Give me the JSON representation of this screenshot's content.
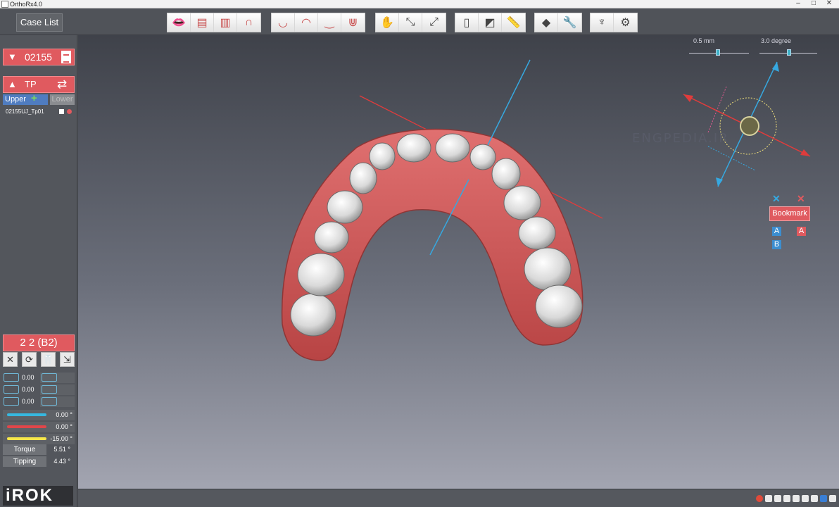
{
  "window": {
    "title": "OrthoRx4.0",
    "min": "–",
    "max": "□",
    "close": "✕"
  },
  "toolbar": {
    "case_list_label": "Case List",
    "groups": [
      {
        "icons": [
          "occlusion-front-icon",
          "upper-jaw-front-icon",
          "lower-jaw-front-icon",
          "arch-outline-icon"
        ],
        "glyphs": [
          "👄",
          "▤",
          "▥",
          "∩"
        ]
      },
      {
        "icons": [
          "upper-teeth-view-icon",
          "lower-teeth-view-icon",
          "gum-view-icon",
          "full-arch-teeth-icon"
        ],
        "glyphs": [
          "◡",
          "◠",
          "‿",
          "⋓"
        ]
      },
      {
        "icons": [
          "hand-pan-icon",
          "shrink-view-icon",
          "expand-view-icon"
        ],
        "glyphs": [
          "✋",
          "⤡",
          "⤢"
        ]
      },
      {
        "icons": [
          "tooth-split-icon",
          "tooth-shape-icon",
          "ruler-icon"
        ],
        "glyphs": [
          "▯",
          "◩",
          "📏"
        ]
      },
      {
        "icons": [
          "eraser-icon",
          "wrench-icon"
        ],
        "glyphs": [
          "◆",
          "🔧"
        ]
      },
      {
        "icons": [
          "jaw-model-icon",
          "attachments-icon"
        ],
        "glyphs": [
          "♆",
          "⚙"
        ]
      }
    ]
  },
  "left_panel": {
    "case_id": "02155",
    "plan_label": "TP",
    "jaw_upper_label": "Upper",
    "jaw_lower_label": "Lower",
    "stage_name": "02155UJ_Tp01",
    "selected_tooth": "2 2 (B2)",
    "tool_buttons": [
      "✕",
      "⟳",
      "🦷",
      "⇲"
    ],
    "rows": [
      {
        "value": "0.00"
      },
      {
        "value": "0.00"
      },
      {
        "value": "0.00"
      }
    ],
    "bars": [
      {
        "color": "#36b8e0",
        "value": "0.00 °"
      },
      {
        "color": "#e0464a",
        "value": "0.00 °"
      },
      {
        "color": "#f5e64a",
        "value": "-15.00 °"
      }
    ],
    "torque_label": "Torque",
    "torque_value": "5.51 °",
    "tipping_label": "Tipping",
    "tipping_value": "4.43 °",
    "logo": "iROK"
  },
  "viewport": {
    "slider_mm_label": "0.5 mm",
    "slider_deg_label": "3.0 degree",
    "watermark": "ENGPEDIA.IR",
    "bookmark_label": "Bookmark",
    "bookmark_keys": [
      "A",
      "A",
      "B"
    ]
  },
  "colors": {
    "accent": "#e05a5f",
    "gum": "#d25a5a",
    "axis_blue": "#36a8e0",
    "axis_red": "#e03c3c"
  }
}
